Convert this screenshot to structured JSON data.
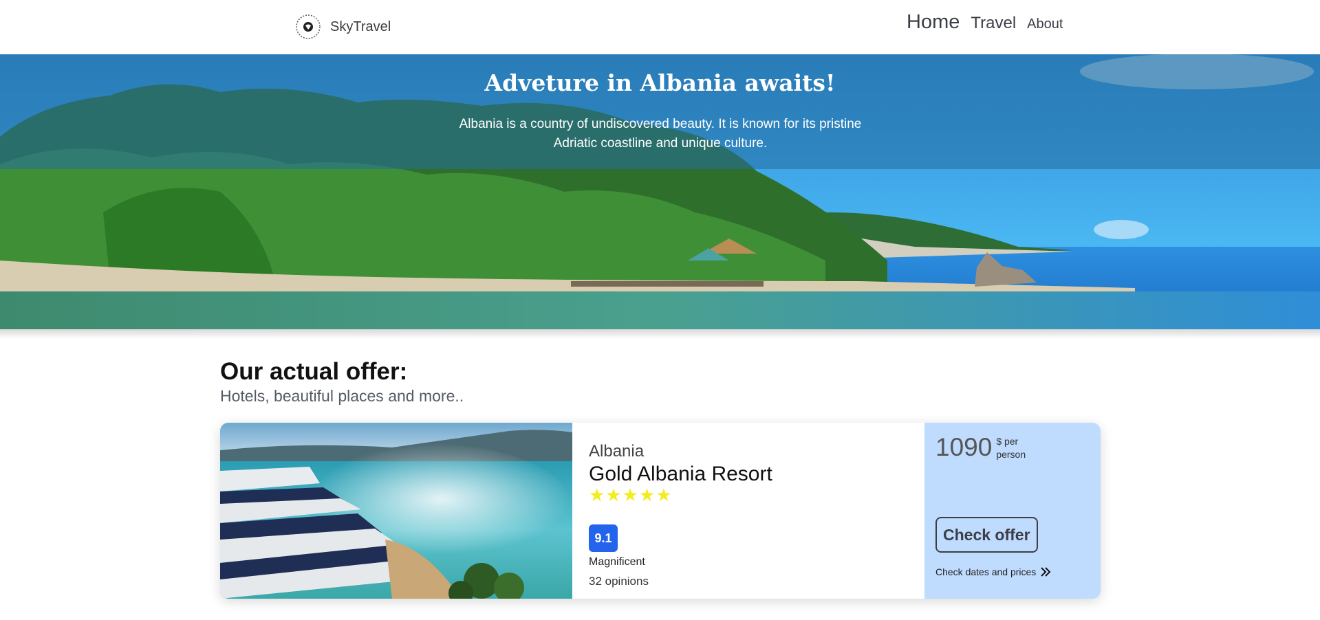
{
  "header": {
    "brand": "SkyTravel",
    "nav": {
      "home": "Home",
      "travel": "Travel",
      "about": "About"
    }
  },
  "hero": {
    "title": "Adveture in Albania awaits!",
    "text": "Albania is a country of undiscovered beauty. It is known for its pristine Adriatic coastline and unique culture."
  },
  "offers": {
    "title": "Our actual offer:",
    "subtitle": "Hotels, beautiful places and more.."
  },
  "card": {
    "country": "Albania",
    "hotel": "Gold Albania Resort",
    "stars": "★★★★★",
    "star_count": 5,
    "rating": "9.1",
    "rating_word": "Magnificent",
    "opinions": "32 opinions",
    "price": "1090",
    "price_unit": "$ per person",
    "check_offer": "Check offer",
    "check_dates": "Check dates and prices"
  },
  "colors": {
    "rating_badge": "#2463eb",
    "price_panel": "#bfdbfe",
    "stars": "#f4ec1f"
  }
}
